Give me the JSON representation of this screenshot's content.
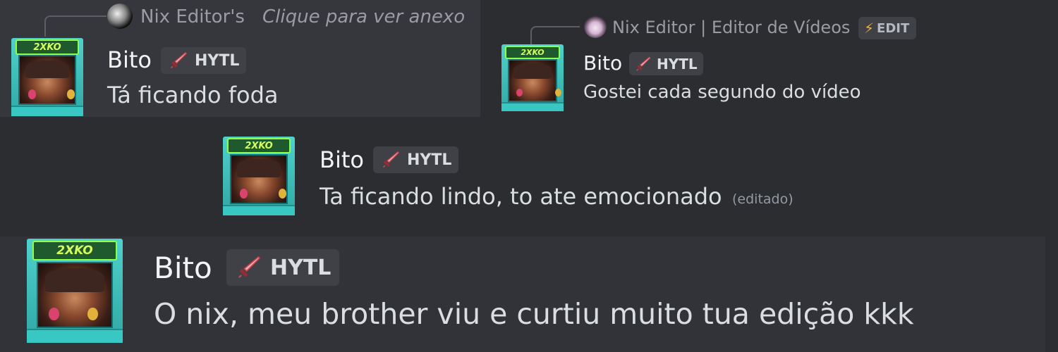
{
  "messages": [
    {
      "reply": {
        "author": "Nix Editor's",
        "text": "Clique para ver anexo",
        "badge": ""
      },
      "author": "Bito",
      "tag": "HYTL",
      "text": "Tá ficando foda",
      "edited": ""
    },
    {
      "reply": {
        "author": "Nix Editor | Editor de Vídeos",
        "text": "",
        "badge": "EDIT"
      },
      "author": "Bito",
      "tag": "HYTL",
      "text": "Gostei cada segundo do vídeo",
      "edited": ""
    },
    {
      "reply": null,
      "author": "Bito",
      "tag": "HYTL",
      "text": "Ta ficando lindo, to ate emocionado",
      "edited": "(editado)"
    },
    {
      "reply": null,
      "author": "Bito",
      "tag": "HYTL",
      "text": "O nix, meu brother viu e curtiu muito tua edição kkk",
      "edited": ""
    }
  ],
  "avatar_marquee": "2XKO",
  "icons": {
    "tag_icon": "sword-icon",
    "badge_icon": "lightning-icon",
    "reply_avatar_1": "anime-avatar-icon",
    "reply_avatar_2": "anime-avatar-icon"
  },
  "colors": {
    "panel_dark": "#2b2d31",
    "panel_light": "#36373d",
    "text": "#dbdee1",
    "muted": "#9b9ca3",
    "tag_bg": "#3f4147",
    "avatar_cyan": "#4fd1cc",
    "avatar_green": "#8dff4a"
  }
}
